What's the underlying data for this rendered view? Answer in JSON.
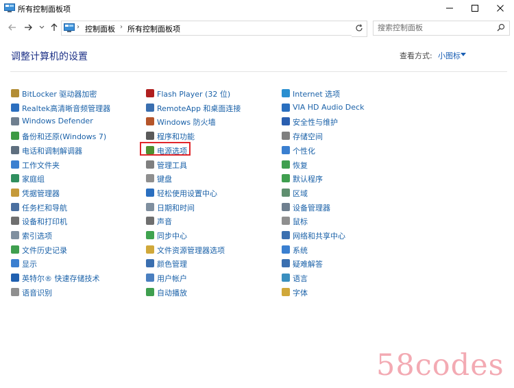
{
  "window": {
    "title": "所有控制面板项"
  },
  "address": {
    "crumbs": [
      "控制面板",
      "所有控制面板项"
    ]
  },
  "search": {
    "placeholder": "搜索控制面板"
  },
  "header": {
    "heading": "调整计算机的设置",
    "view_by_label": "查看方式:",
    "view_by_value": "小图标"
  },
  "columns": [
    {
      "items": [
        {
          "label": "BitLocker 驱动器加密",
          "icon": "bitlocker-icon",
          "color": "#b28d35"
        },
        {
          "label": "Realtek高清晰音频管理器",
          "icon": "realtek-audio-icon",
          "color": "#2c6fbf"
        },
        {
          "label": "Windows Defender",
          "icon": "defender-icon",
          "color": "#6f7f8f"
        },
        {
          "label": "备份和还原(Windows 7)",
          "icon": "backup-icon",
          "color": "#3d9a43"
        },
        {
          "label": "电话和调制解调器",
          "icon": "phone-modem-icon",
          "color": "#5f6f7f"
        },
        {
          "label": "工作文件夹",
          "icon": "work-folders-icon",
          "color": "#3a7fd0"
        },
        {
          "label": "家庭组",
          "icon": "homegroup-icon",
          "color": "#2f8f5f"
        },
        {
          "label": "凭据管理器",
          "icon": "credential-icon",
          "color": "#c59a3a"
        },
        {
          "label": "任务栏和导航",
          "icon": "taskbar-icon",
          "color": "#4a6f9f"
        },
        {
          "label": "设备和打印机",
          "icon": "printer-icon",
          "color": "#6f6f6f"
        },
        {
          "label": "索引选项",
          "icon": "indexing-icon",
          "color": "#7f8f9f"
        },
        {
          "label": "文件历史记录",
          "icon": "file-history-icon",
          "color": "#3f9f4f"
        },
        {
          "label": "显示",
          "icon": "display-icon",
          "color": "#3a7fd0"
        },
        {
          "label": "英特尔® 快速存储技术",
          "icon": "intel-rst-icon",
          "color": "#2060b0"
        },
        {
          "label": "语音识别",
          "icon": "microphone-icon",
          "color": "#8f8f8f"
        }
      ]
    },
    {
      "items": [
        {
          "label": "Flash Player (32 位)",
          "icon": "flash-icon",
          "color": "#b01f1f"
        },
        {
          "label": "RemoteApp 和桌面连接",
          "icon": "remoteapp-icon",
          "color": "#3a6fb0"
        },
        {
          "label": "Windows 防火墙",
          "icon": "firewall-icon",
          "color": "#b5552a"
        },
        {
          "label": "程序和功能",
          "icon": "programs-icon",
          "color": "#5a5a5a"
        },
        {
          "label": "电源选项",
          "icon": "power-icon",
          "color": "#4f8f2f"
        },
        {
          "label": "管理工具",
          "icon": "admin-tools-icon",
          "color": "#7f7f7f"
        },
        {
          "label": "键盘",
          "icon": "keyboard-icon",
          "color": "#8f8f8f"
        },
        {
          "label": "轻松使用设置中心",
          "icon": "ease-access-icon",
          "color": "#2a6fc0"
        },
        {
          "label": "日期和时间",
          "icon": "datetime-icon",
          "color": "#7f8f9f"
        },
        {
          "label": "声音",
          "icon": "sound-icon",
          "color": "#6f6f6f"
        },
        {
          "label": "同步中心",
          "icon": "sync-icon",
          "color": "#3fa34f"
        },
        {
          "label": "文件资源管理器选项",
          "icon": "explorer-options-icon",
          "color": "#d0a83a"
        },
        {
          "label": "颜色管理",
          "icon": "color-mgmt-icon",
          "color": "#3a6fb0"
        },
        {
          "label": "用户帐户",
          "icon": "user-accounts-icon",
          "color": "#4a7fc0"
        },
        {
          "label": "自动播放",
          "icon": "autoplay-icon",
          "color": "#3f9f4f"
        }
      ]
    },
    {
      "items": [
        {
          "label": "Internet 选项",
          "icon": "internet-options-icon",
          "color": "#2a8fd0"
        },
        {
          "label": "VIA HD Audio Deck",
          "icon": "via-audio-icon",
          "color": "#2a6fbf"
        },
        {
          "label": "安全性与维护",
          "icon": "security-flag-icon",
          "color": "#2a5fb0"
        },
        {
          "label": "存储空间",
          "icon": "storage-icon",
          "color": "#7f7f7f"
        },
        {
          "label": "个性化",
          "icon": "personalization-icon",
          "color": "#3a7fd0"
        },
        {
          "label": "恢复",
          "icon": "recovery-icon",
          "color": "#3f9f4f"
        },
        {
          "label": "默认程序",
          "icon": "default-programs-icon",
          "color": "#3f9f4f"
        },
        {
          "label": "区域",
          "icon": "region-icon",
          "color": "#5f8f6f"
        },
        {
          "label": "设备管理器",
          "icon": "device-manager-icon",
          "color": "#6f7f8f"
        },
        {
          "label": "鼠标",
          "icon": "mouse-icon",
          "color": "#8f8f8f"
        },
        {
          "label": "网络和共享中心",
          "icon": "network-icon",
          "color": "#3a6fb0"
        },
        {
          "label": "系统",
          "icon": "system-icon",
          "color": "#3a7fd0"
        },
        {
          "label": "疑难解答",
          "icon": "troubleshoot-icon",
          "color": "#3a6fb0"
        },
        {
          "label": "语言",
          "icon": "language-icon",
          "color": "#3a8fbf"
        },
        {
          "label": "字体",
          "icon": "fonts-icon",
          "color": "#d0a83a"
        }
      ]
    }
  ],
  "watermark": {
    "text": "58codes"
  }
}
